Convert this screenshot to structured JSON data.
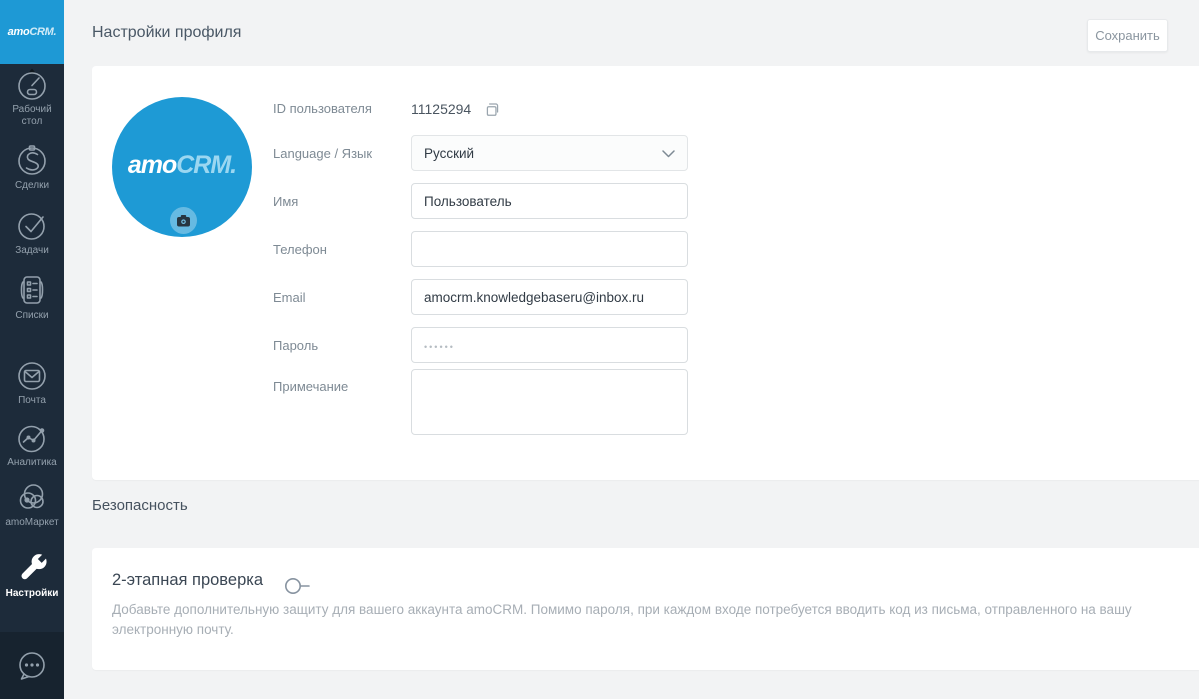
{
  "app": {
    "logo_amo": "amo",
    "logo_crm": "CRM.",
    "brand_color": "#1e99d5",
    "sidebar_bg": "#1d2b3a",
    "avatar_color": "#1e9ad5"
  },
  "sidebar": {
    "items": [
      {
        "label": "Рабочий стол",
        "icon": "gauge-icon",
        "active": false
      },
      {
        "label": "Сделки",
        "icon": "deals-icon",
        "active": false
      },
      {
        "label": "Задачи",
        "icon": "tasks-icon",
        "active": false
      },
      {
        "label": "Списки",
        "icon": "lists-icon",
        "active": false
      },
      {
        "label": "Почта",
        "icon": "mail-icon",
        "active": false
      },
      {
        "label": "Аналитика",
        "icon": "analytics-icon",
        "active": false
      },
      {
        "label": "amoМаркет",
        "icon": "market-icon",
        "active": false
      },
      {
        "label": "Настройки",
        "icon": "wrench-icon",
        "active": true
      }
    ],
    "chat": {
      "icon": "chat-icon"
    }
  },
  "header": {
    "title": "Настройки профиля",
    "save_label": "Сохранить"
  },
  "profile": {
    "id_label": "ID пользователя",
    "id_value": "11125294",
    "language_label": "Language / Язык",
    "language_value": "Русский",
    "name_label": "Имя",
    "name_value": "Пользователь",
    "phone_label": "Телефон",
    "phone_value": "",
    "email_label": "Email",
    "email_value": "amocrm.knowledgebaseru@inbox.ru",
    "password_label": "Пароль",
    "password_placeholder": "••••••",
    "note_label": "Примечание",
    "note_value": ""
  },
  "security": {
    "section_title": "Безопасность",
    "two_factor_title": "2-этапная проверка",
    "two_factor_enabled": false,
    "two_factor_description": "Добавьте дополнительную защиту для вашего аккаунта amoCRM. Помимо пароля, при каждом входе потребуется вводить код из письма, отправленного на вашу электронную почту."
  }
}
